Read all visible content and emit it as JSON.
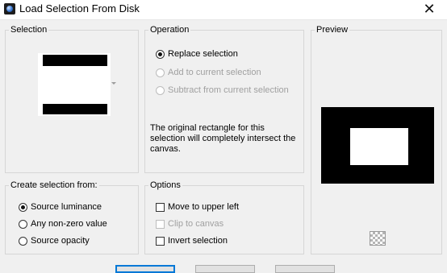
{
  "window": {
    "title": "Load Selection From Disk",
    "close_glyph": "✕"
  },
  "selection": {
    "title": "Selection"
  },
  "operation": {
    "title": "Operation",
    "options": [
      {
        "label": "Replace selection",
        "checked": true,
        "enabled": true
      },
      {
        "label": "Add to current selection",
        "checked": false,
        "enabled": false
      },
      {
        "label": "Subtract from current selection",
        "checked": false,
        "enabled": false
      }
    ],
    "info_text": "The original rectangle for this selection will completely intersect the canvas."
  },
  "preview": {
    "title": "Preview"
  },
  "create_from": {
    "title": "Create selection from:",
    "options": [
      {
        "label": "Source luminance",
        "checked": true
      },
      {
        "label": "Any non-zero value",
        "checked": false
      },
      {
        "label": "Source opacity",
        "checked": false
      }
    ]
  },
  "options": {
    "title": "Options",
    "items": [
      {
        "label": "Move to upper left",
        "checked": false,
        "enabled": true
      },
      {
        "label": "Clip to canvas",
        "checked": false,
        "enabled": false
      },
      {
        "label": "Invert selection",
        "checked": false,
        "enabled": true
      }
    ]
  },
  "colors": {
    "accent": "#0078d7",
    "group_border": "#d6d6d6",
    "background": "#f0f0f0"
  }
}
